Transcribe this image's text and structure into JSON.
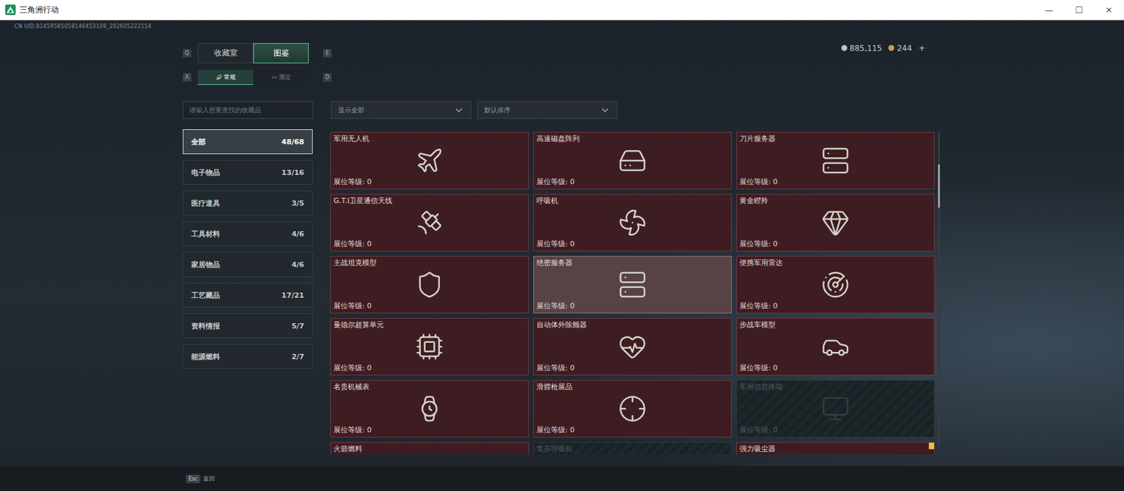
{
  "window": {
    "title": "三角洲行动",
    "controls": [
      "—",
      "☐",
      "✕"
    ]
  },
  "uid": "CN UID:81459585058146453109_202605222154",
  "tabs": [
    {
      "label": "收藏室",
      "selected": false
    },
    {
      "label": "图鉴",
      "selected": true
    }
  ],
  "tab_keys": [
    "Q",
    "E"
  ],
  "subtabs": [
    {
      "label": "常规",
      "selected": true
    },
    {
      "label": "限定",
      "selected": false
    }
  ],
  "subtab_keys": [
    "A",
    "D"
  ],
  "currency": [
    {
      "amount": "885,115",
      "kind": "silver"
    },
    {
      "amount": "244",
      "kind": "gold"
    }
  ],
  "currency_add": "+",
  "search": {
    "placeholder": "请输入想要查找的收藏品"
  },
  "filters": [
    {
      "label": "显示全部"
    },
    {
      "label": "默认排序"
    }
  ],
  "categories": [
    {
      "name": "全部",
      "count": "48/68",
      "selected": true
    },
    {
      "name": "电子物品",
      "count": "13/16",
      "selected": false
    },
    {
      "name": "医疗道具",
      "count": "3/5",
      "selected": false
    },
    {
      "name": "工具材料",
      "count": "4/6",
      "selected": false
    },
    {
      "name": "家居物品",
      "count": "4/6",
      "selected": false
    },
    {
      "name": "工艺藏品",
      "count": "17/21",
      "selected": false
    },
    {
      "name": "资料情报",
      "count": "5/7",
      "selected": false
    },
    {
      "name": "能源燃料",
      "count": "2/7",
      "selected": false
    }
  ],
  "items": [
    {
      "name": "军用无人机",
      "booth": "展位等级: 0",
      "kind": "owned",
      "highlighted": false,
      "marked": false
    },
    {
      "name": "高速磁盘阵列",
      "booth": "展位等级: 0",
      "kind": "owned",
      "highlighted": false,
      "marked": false
    },
    {
      "name": "刀片服务器",
      "booth": "展位等级: 0",
      "kind": "owned",
      "highlighted": false,
      "marked": false
    },
    {
      "name": "G.T.I卫星通信天线",
      "booth": "展位等级: 0",
      "kind": "owned",
      "highlighted": false,
      "marked": false
    },
    {
      "name": "呼吸机",
      "booth": "展位等级: 0",
      "kind": "owned",
      "highlighted": false,
      "marked": false
    },
    {
      "name": "黄金瞪羚",
      "booth": "展位等级: 0",
      "kind": "owned",
      "highlighted": false,
      "marked": false
    },
    {
      "name": "主战坦克模型",
      "booth": "展位等级: 0",
      "kind": "owned",
      "highlighted": false,
      "marked": false
    },
    {
      "name": "绝密服务器",
      "booth": "展位等级: 0",
      "kind": "owned",
      "highlighted": true,
      "marked": false
    },
    {
      "name": "便携军用雷达",
      "booth": "展位等级: 0",
      "kind": "owned",
      "highlighted": false,
      "marked": false
    },
    {
      "name": "曼德尔超算单元",
      "booth": "展位等级: 0",
      "kind": "owned",
      "highlighted": false,
      "marked": false
    },
    {
      "name": "自动体外除颤器",
      "booth": "展位等级: 0",
      "kind": "owned",
      "highlighted": false,
      "marked": false
    },
    {
      "name": "步战车模型",
      "booth": "展位等级: 0",
      "kind": "owned",
      "highlighted": false,
      "marked": false
    },
    {
      "name": "名贵机械表",
      "booth": "展位等级: 0",
      "kind": "owned",
      "highlighted": false,
      "marked": false
    },
    {
      "name": "滑膛枪展品",
      "booth": "展位等级: 0",
      "kind": "owned",
      "highlighted": false,
      "marked": false
    },
    {
      "name": "军用信息终端",
      "booth": "展位等级: 0",
      "kind": "locked",
      "highlighted": false,
      "marked": false
    },
    {
      "name": "火箭燃料",
      "kind": "owned",
      "highlighted": false,
      "marked": false
    },
    {
      "name": "复苏呼吸机",
      "kind": "locked",
      "highlighted": false,
      "marked": false
    },
    {
      "name": "强力吸尘器",
      "kind": "owned",
      "highlighted": false,
      "marked": true
    }
  ],
  "footer": {
    "key": "Esc",
    "label": "返回"
  }
}
